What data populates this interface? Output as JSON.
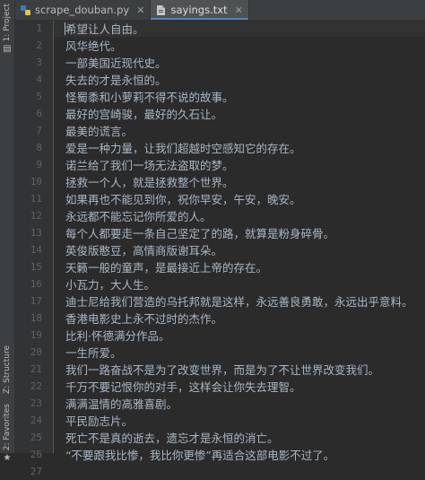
{
  "sidebar": {
    "project_tab": "1: Project",
    "structure_tab": "Z: Structure",
    "favorites_tab": "2: Favorites"
  },
  "tabs": [
    {
      "label": "scrape_douban.py",
      "icon": "python-file-icon",
      "active": false
    },
    {
      "label": "sayings.txt",
      "icon": "text-file-icon",
      "active": true
    }
  ],
  "editor": {
    "lines": [
      {
        "n": "1",
        "text": "希望让人自由。"
      },
      {
        "n": "2",
        "text": "风华绝代。"
      },
      {
        "n": "3",
        "text": "一部美国近现代史。"
      },
      {
        "n": "4",
        "text": "失去的才是永恒的。"
      },
      {
        "n": "5",
        "text": "怪蜀黍和小萝莉不得不说的故事。"
      },
      {
        "n": "6",
        "text": "最好的宫崎骏，最好的久石让。"
      },
      {
        "n": "7",
        "text": "最美的谎言。"
      },
      {
        "n": "8",
        "text": "爱是一种力量，让我们超越时空感知它的存在。"
      },
      {
        "n": "9",
        "text": "诺兰给了我们一场无法盗取的梦。"
      },
      {
        "n": "10",
        "text": "拯救一个人，就是拯救整个世界。"
      },
      {
        "n": "11",
        "text": "如果再也不能见到你，祝你早安，午安，晚安。"
      },
      {
        "n": "12",
        "text": "永远都不能忘记你所爱的人。"
      },
      {
        "n": "13",
        "text": "每个人都要走一条自己坚定了的路，就算是粉身碎骨。"
      },
      {
        "n": "14",
        "text": "英俊版憨豆，高情商版谢耳朵。"
      },
      {
        "n": "15",
        "text": "天籁一般的童声，是最接近上帝的存在。"
      },
      {
        "n": "16",
        "text": "小瓦力，大人生。"
      },
      {
        "n": "17",
        "text": "迪士尼给我们营造的乌托邦就是这样，永远善良勇敢，永远出乎意料。"
      },
      {
        "n": "18",
        "text": "香港电影史上永不过时的杰作。"
      },
      {
        "n": "19",
        "text": "比利·怀德满分作品。"
      },
      {
        "n": "20",
        "text": "一生所爱。"
      },
      {
        "n": "21",
        "text": "我们一路奋战不是为了改变世界，而是为了不让世界改变我们。"
      },
      {
        "n": "22",
        "text": "千万不要记恨你的对手，这样会让你失去理智。"
      },
      {
        "n": "23",
        "text": "满满温情的高雅喜剧。"
      },
      {
        "n": "24",
        "text": "平民励志片。"
      },
      {
        "n": "25",
        "text": "死亡不是真的逝去，遗忘才是永恒的消亡。"
      },
      {
        "n": "26",
        "text": "“不要跟我比惨，我比你更惨”再适合这部电影不过了。"
      },
      {
        "n": "27",
        "text": ""
      }
    ],
    "current_line": 1
  }
}
